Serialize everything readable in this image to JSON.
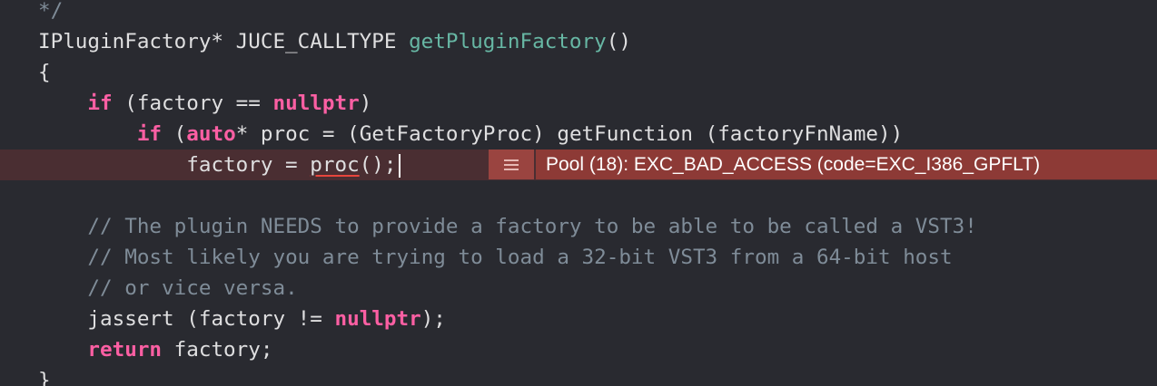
{
  "editor": {
    "lines": {
      "l0": {
        "comment": "*/"
      },
      "l1": {
        "type": "IPluginFactory* JUCE_CALLTYPE ",
        "fn": "getPluginFactory",
        "rest": "()"
      },
      "l2": {
        "text": "{"
      },
      "l3": {
        "indent": "    ",
        "kw": "if",
        "mid": " (factory == ",
        "kw2": "nullptr",
        "rest": ")"
      },
      "l4": {
        "indent": "        ",
        "kw": "if",
        "mid": " (",
        "kw2": "auto",
        "rest": "* proc = (GetFactoryProc) getFunction (factoryFnName))"
      },
      "l5": {
        "indent": "            ",
        "pre": "factory = ",
        "squiggled": "proc",
        "rest": "();"
      },
      "l7": {
        "indent": "    ",
        "comment": "// The plugin NEEDS to provide a factory to be able to be called a VST3!"
      },
      "l8": {
        "indent": "    ",
        "comment": "// Most likely you are trying to load a 32-bit VST3 from a 64-bit host"
      },
      "l9": {
        "indent": "    ",
        "comment": "// or vice versa."
      },
      "l10": {
        "indent": "    ",
        "pre": "jassert (factory != ",
        "kw": "nullptr",
        "rest": ");"
      },
      "l11": {
        "indent": "    ",
        "kw": "return",
        "rest": " factory;"
      },
      "l12": {
        "text": "}"
      }
    }
  },
  "error_banner": {
    "icon": "menu-lines-icon",
    "message": "Pool (18): EXC_BAD_ACCESS (code=EXC_I386_GPFLT)",
    "colors": {
      "icon_bg": "#9a4440",
      "message_bg": "#8d3a36",
      "line_highlight": "#4a2e32"
    }
  },
  "colors": {
    "background": "#292a30",
    "keyword": "#fc5fa3",
    "function": "#67b7a4",
    "comment": "#7f8c98",
    "plain": "#dfdfe0"
  }
}
